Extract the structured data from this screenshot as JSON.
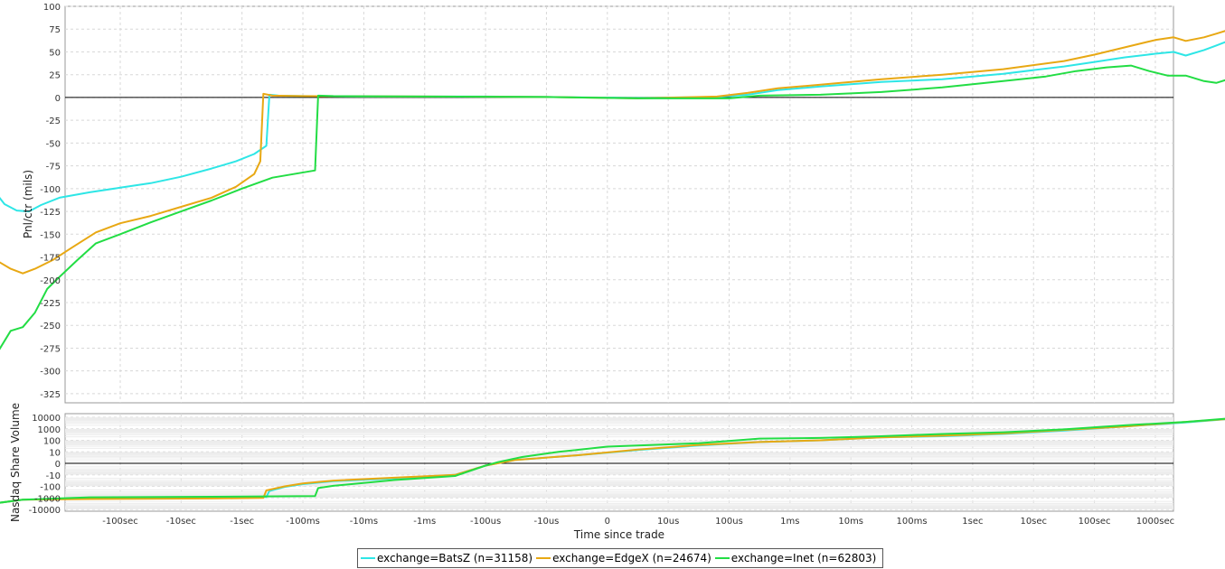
{
  "chart_data": [
    {
      "type": "line",
      "ylabel": "Pnl/ctr (mils)",
      "ylim": [
        -335,
        100
      ],
      "yticks": [
        "100",
        "75",
        "50",
        "25",
        "0",
        "-25",
        "-50",
        "-75",
        "-100",
        "-125",
        "-150",
        "-175",
        "-200",
        "-225",
        "-250",
        "-275",
        "-300",
        "-325"
      ],
      "grid": true,
      "series": [
        {
          "name": "exchange=BatsZ (n=31158)",
          "color": "#2ee6e6",
          "points": [
            [
              -2.8,
              12
            ],
            [
              -2.7,
              -15
            ],
            [
              -2.5,
              -55
            ],
            [
              -2.3,
              -78
            ],
            [
              -2.1,
              -100
            ],
            [
              -1.9,
              -117
            ],
            [
              -1.7,
              -124
            ],
            [
              -1.5,
              -125
            ],
            [
              -1.3,
              -118
            ],
            [
              -1.0,
              -110
            ],
            [
              -0.5,
              -104
            ],
            [
              0,
              -99
            ],
            [
              0.5,
              -94
            ],
            [
              1.0,
              -87
            ],
            [
              1.5,
              -78
            ],
            [
              1.9,
              -70
            ],
            [
              2.2,
              -62
            ],
            [
              2.4,
              -53
            ],
            [
              2.45,
              3
            ],
            [
              2.6,
              2
            ],
            [
              3.0,
              1.5
            ],
            [
              4.0,
              1
            ],
            [
              5.0,
              1
            ],
            [
              6.0,
              1
            ],
            [
              7.0,
              0.5
            ],
            [
              8.5,
              -0.5
            ],
            [
              9.8,
              0.5
            ],
            [
              10.3,
              3
            ],
            [
              10.8,
              8
            ],
            [
              11.5,
              12
            ],
            [
              12.5,
              17
            ],
            [
              13.5,
              20
            ],
            [
              14.5,
              26
            ],
            [
              15.5,
              34
            ],
            [
              16.0,
              39
            ],
            [
              16.5,
              44
            ],
            [
              17.0,
              48
            ],
            [
              17.3,
              50
            ],
            [
              17.5,
              46
            ],
            [
              17.8,
              52
            ],
            [
              18.0,
              57
            ],
            [
              18.2,
              62
            ],
            [
              18.3,
              66
            ]
          ]
        },
        {
          "name": "exchange=EdgeX (n=24674)",
          "color": "#e8a813",
          "points": [
            [
              -2.8,
              -95
            ],
            [
              -2.7,
              -120
            ],
            [
              -2.5,
              -150
            ],
            [
              -2.3,
              -172
            ],
            [
              -2.0,
              -180
            ],
            [
              -1.8,
              -188
            ],
            [
              -1.6,
              -193
            ],
            [
              -1.4,
              -188
            ],
            [
              -1.1,
              -178
            ],
            [
              -0.8,
              -165
            ],
            [
              -0.4,
              -148
            ],
            [
              0,
              -138
            ],
            [
              0.5,
              -130
            ],
            [
              1.0,
              -120
            ],
            [
              1.5,
              -110
            ],
            [
              1.9,
              -98
            ],
            [
              2.2,
              -84
            ],
            [
              2.3,
              -70
            ],
            [
              2.35,
              4
            ],
            [
              2.5,
              2
            ],
            [
              3.0,
              1.5
            ],
            [
              5.0,
              1
            ],
            [
              7.0,
              0.5
            ],
            [
              8.5,
              -1
            ],
            [
              9.8,
              1
            ],
            [
              10.3,
              5
            ],
            [
              10.8,
              10
            ],
            [
              11.5,
              14
            ],
            [
              12.5,
              20
            ],
            [
              13.5,
              25
            ],
            [
              14.5,
              31
            ],
            [
              15.5,
              40
            ],
            [
              16.0,
              47
            ],
            [
              16.5,
              55
            ],
            [
              17.0,
              63
            ],
            [
              17.3,
              66
            ],
            [
              17.5,
              62
            ],
            [
              17.8,
              66
            ],
            [
              18.0,
              70
            ],
            [
              18.2,
              74
            ],
            [
              18.3,
              74
            ]
          ]
        },
        {
          "name": "exchange=Inet (n=62803)",
          "color": "#22dd44",
          "points": [
            [
              -2.8,
              -318
            ],
            [
              -2.7,
              -318
            ],
            [
              -2.6,
              -322
            ],
            [
              -2.4,
              -312
            ],
            [
              -2.2,
              -300
            ],
            [
              -2.0,
              -278
            ],
            [
              -1.8,
              -256
            ],
            [
              -1.6,
              -252
            ],
            [
              -1.4,
              -236
            ],
            [
              -1.2,
              -210
            ],
            [
              -1.0,
              -197
            ],
            [
              -0.7,
              -178
            ],
            [
              -0.4,
              -160
            ],
            [
              0,
              -150
            ],
            [
              0.5,
              -137
            ],
            [
              1.0,
              -125
            ],
            [
              1.5,
              -113
            ],
            [
              2.0,
              -100
            ],
            [
              2.5,
              -88
            ],
            [
              3.2,
              -80
            ],
            [
              3.25,
              2
            ],
            [
              3.5,
              1.5
            ],
            [
              5.0,
              1
            ],
            [
              7.0,
              0.5
            ],
            [
              8.5,
              -1
            ],
            [
              10.0,
              -1
            ],
            [
              10.5,
              2
            ],
            [
              11.5,
              3
            ],
            [
              12.5,
              6
            ],
            [
              13.5,
              11
            ],
            [
              14.5,
              18
            ],
            [
              15.2,
              23
            ],
            [
              15.7,
              29
            ],
            [
              16.2,
              33
            ],
            [
              16.6,
              35
            ],
            [
              16.9,
              29
            ],
            [
              17.2,
              24
            ],
            [
              17.5,
              24
            ],
            [
              17.8,
              18
            ],
            [
              18.0,
              16
            ],
            [
              18.2,
              20
            ],
            [
              18.3,
              22
            ]
          ]
        }
      ]
    },
    {
      "type": "line",
      "ylabel": "Nasdaq Share Volume",
      "yscale": "symlog",
      "ylim": [
        -10000,
        10000
      ],
      "yticks": [
        "10000",
        "1000",
        "100",
        "10",
        "0",
        "-10",
        "-100",
        "-1000",
        "-10000"
      ],
      "xlabel": "Time since trade",
      "xscale": "symlog",
      "xticks": [
        "-100sec",
        "-10sec",
        "-1sec",
        "-100ms",
        "-10ms",
        "-1ms",
        "-100us",
        "-10us",
        "0",
        "10us",
        "100us",
        "1ms",
        "10ms",
        "100ms",
        "1sec",
        "10sec",
        "100sec",
        "1000sec"
      ],
      "series": [
        {
          "name": "exchange=BatsZ (n=31158)",
          "color": "#2ee6e6",
          "points": [
            [
              -2.8,
              -4
            ],
            [
              -1.6,
              -3.15
            ],
            [
              -0.5,
              -3.05
            ],
            [
              1.5,
              -3.0
            ],
            [
              2.4,
              -2.92
            ],
            [
              2.45,
              -2.4
            ],
            [
              2.7,
              -2.05
            ],
            [
              3.0,
              -1.8
            ],
            [
              3.5,
              -1.55
            ],
            [
              4.5,
              -1.3
            ],
            [
              5.5,
              -1.0
            ],
            [
              6.0,
              -0.2
            ],
            [
              6.5,
              0.3
            ],
            [
              7.5,
              0.7
            ],
            [
              8.5,
              1.15
            ],
            [
              9.5,
              1.55
            ],
            [
              10.5,
              1.85
            ],
            [
              11.5,
              2.0
            ],
            [
              12.5,
              2.25
            ],
            [
              13.5,
              2.35
            ],
            [
              14.5,
              2.55
            ],
            [
              15.5,
              2.85
            ],
            [
              16.5,
              3.2
            ],
            [
              17.5,
              3.55
            ],
            [
              18.2,
              3.85
            ]
          ]
        },
        {
          "name": "exchange=EdgeX (n=24674)",
          "color": "#e8a813",
          "points": [
            [
              -2.8,
              -4
            ],
            [
              -1.6,
              -3.15
            ],
            [
              -0.5,
              -3.1
            ],
            [
              1.5,
              -3.05
            ],
            [
              2.35,
              -3.0
            ],
            [
              2.4,
              -2.35
            ],
            [
              2.7,
              -2.0
            ],
            [
              3.0,
              -1.75
            ],
            [
              3.5,
              -1.5
            ],
            [
              4.5,
              -1.25
            ],
            [
              5.5,
              -1.0
            ],
            [
              6.0,
              -0.2
            ],
            [
              6.5,
              0.3
            ],
            [
              7.5,
              0.7
            ],
            [
              8.5,
              1.2
            ],
            [
              9.5,
              1.6
            ],
            [
              10.5,
              1.85
            ],
            [
              11.5,
              2.0
            ],
            [
              12.5,
              2.25
            ],
            [
              13.5,
              2.4
            ],
            [
              14.5,
              2.6
            ],
            [
              15.5,
              2.9
            ],
            [
              16.5,
              3.2
            ],
            [
              17.5,
              3.6
            ],
            [
              18.2,
              3.85
            ]
          ]
        },
        {
          "name": "exchange=Inet (n=62803)",
          "color": "#22dd44",
          "points": [
            [
              -2.8,
              -4
            ],
            [
              -1.6,
              -3.15
            ],
            [
              -0.5,
              -2.95
            ],
            [
              1.5,
              -2.9
            ],
            [
              3.2,
              -2.85
            ],
            [
              3.25,
              -2.15
            ],
            [
              3.5,
              -1.95
            ],
            [
              4.5,
              -1.45
            ],
            [
              5.5,
              -1.1
            ],
            [
              6.0,
              -0.2
            ],
            [
              6.2,
              0.1
            ],
            [
              6.6,
              0.55
            ],
            [
              7.2,
              1.0
            ],
            [
              8.0,
              1.45
            ],
            [
              9.5,
              1.75
            ],
            [
              10.5,
              2.15
            ],
            [
              11.5,
              2.2
            ],
            [
              12.5,
              2.35
            ],
            [
              13.5,
              2.55
            ],
            [
              14.5,
              2.7
            ],
            [
              15.5,
              2.95
            ],
            [
              16.5,
              3.3
            ],
            [
              17.5,
              3.6
            ],
            [
              18.2,
              3.9
            ]
          ]
        }
      ]
    }
  ]
}
